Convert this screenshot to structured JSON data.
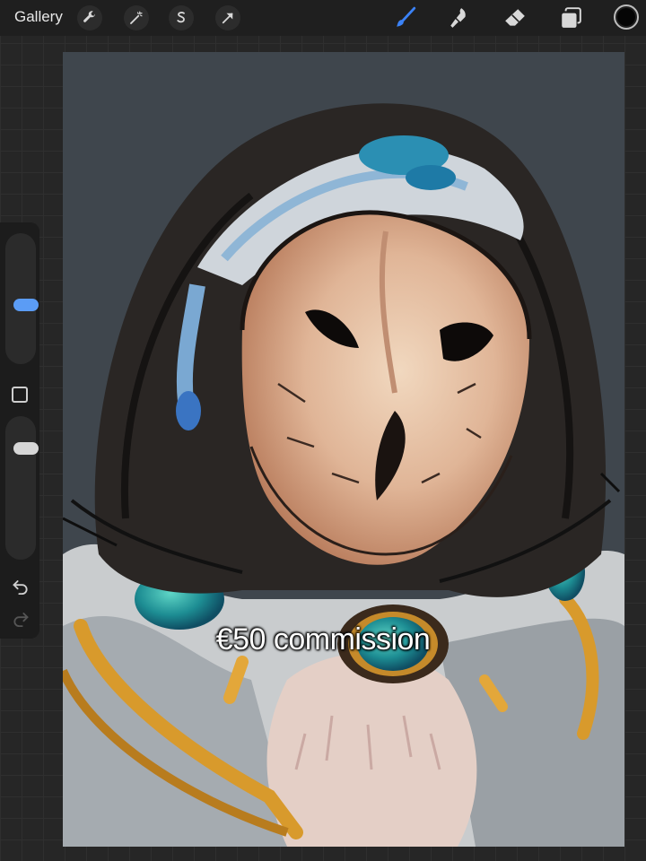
{
  "app": {
    "toolbar": {
      "gallery_label": "Gallery",
      "left_tools": [
        "wrench-icon",
        "magic-wand-icon",
        "selection-s-icon",
        "transform-arrow-icon"
      ],
      "right_tools": [
        "brush-icon",
        "smudge-icon",
        "eraser-icon",
        "layers-icon"
      ],
      "active_tool": "brush-icon",
      "active_color": "#050505",
      "accent": "#3b82f6"
    },
    "sidebar": {
      "brush_size_level": 0.45,
      "opacity_level": 0.2,
      "accent": "#5b9cf5"
    }
  },
  "artwork": {
    "subject": "owl",
    "background_color": "#3f464d"
  },
  "overlay": {
    "caption": "€50 commission"
  }
}
